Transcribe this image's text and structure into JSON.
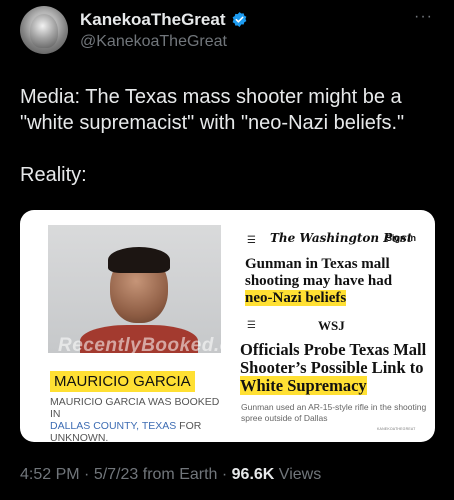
{
  "user": {
    "name": "KanekoaTheGreat",
    "handle": "@KanekoaTheGreat",
    "verified_color": "#1d9bf0"
  },
  "more_icon": "more-dots-icon",
  "tweet": {
    "line1": "Media: The Texas mass shooter might be a",
    "line2": "\"white supremacist\" with \"neo-Nazi beliefs.\"",
    "line3": "Reality:"
  },
  "card": {
    "mugshot_watermark": "RecentlyBooked.com",
    "name_label": "MAURICIO GARCIA",
    "caption_line1": "MAURICIO GARCIA WAS BOOKED IN",
    "caption_line2_blue": "DALLAS COUNTY, TEXAS",
    "caption_line2_rest": " FOR",
    "caption_line3": "UNKNOWN.",
    "wapo": {
      "menu": "☰",
      "logo": "The Washington Post",
      "sign_in": "Sign in",
      "headline_part1": "Gunman in Texas mall shooting may have had ",
      "headline_highlight": "neo-Nazi beliefs"
    },
    "wsj": {
      "menu": "☰",
      "logo": "WSJ",
      "headline_part1": "Officials Probe Texas Mall Shooter’s Possible Link to ",
      "headline_highlight": "White Supremacy",
      "subtitle": "Gunman used an AR-15-style rifle in the shooting spree outside of Dallas",
      "tiny_credit": "KANEKOATHEGREAT"
    }
  },
  "meta": {
    "time": "4:52 PM",
    "sep1": " · ",
    "date": "5/7/23 from Earth",
    "sep2": " · ",
    "views_count": "96.6K",
    "views_label": " Views"
  },
  "colors": {
    "background": "#000000",
    "text": "#e7e9ea",
    "secondary": "#71767b",
    "highlight": "#ffe033"
  }
}
